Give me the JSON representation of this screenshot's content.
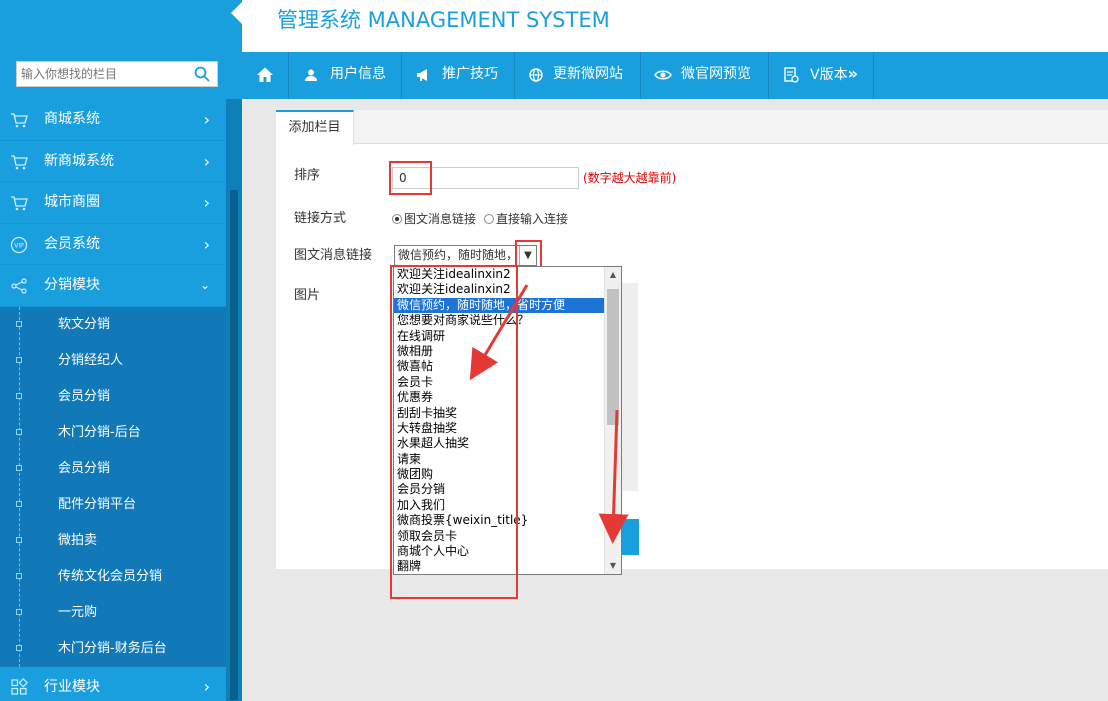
{
  "header": {
    "title": "管理系统 MANAGEMENT SYSTEM"
  },
  "search": {
    "placeholder": "输入你想找的栏目"
  },
  "sidebar": {
    "items": [
      {
        "label": "商城系统",
        "icon": "cart-icon"
      },
      {
        "label": "新商城系统",
        "icon": "cart-icon"
      },
      {
        "label": "城市商圈",
        "icon": "cart-icon"
      },
      {
        "label": "会员系统",
        "icon": "vip-icon"
      },
      {
        "label": "分销模块",
        "icon": "share-icon"
      }
    ],
    "sub_items": [
      "软文分销",
      "分销经纪人",
      "会员分销",
      "木门分销-后台",
      "会员分销",
      "配件分销平台",
      "微拍卖",
      "传统文化会员分销",
      "一元购",
      "木门分销-财务后台"
    ],
    "bottom_item": {
      "label": "行业模块",
      "icon": "grid-icon"
    }
  },
  "topnav": {
    "home_icon": "home-icon",
    "items": [
      {
        "label": "用户信息",
        "icon": "user-icon"
      },
      {
        "label": "推广技巧",
        "icon": "megaphone-icon"
      },
      {
        "label": "更新微网站",
        "icon": "globe-icon"
      },
      {
        "label": "微官网预览",
        "icon": "eye-icon"
      },
      {
        "label": "V版本",
        "icon": "version-icon"
      }
    ]
  },
  "panel": {
    "tab": "添加栏目",
    "order_label": "排序",
    "order_value": "0",
    "order_hint": "(数字越大越靠前)",
    "link_label": "链接方式",
    "radio_option1": "图文消息链接",
    "radio_option2": "直接输入连接",
    "news_label": "图文消息链接",
    "selected_value": "微信预约，随时随地，",
    "image_label": "图片"
  },
  "dropdown": {
    "selected_index": 2,
    "options": [
      "欢迎关注idealinxin2",
      "欢迎关注idealinxin2",
      "微信预约，随时随地，省时方便",
      "您想要对商家说些什么？",
      "在线调研",
      "微相册",
      "微喜帖",
      "会员卡",
      "优惠券",
      "刮刮卡抽奖",
      "大转盘抽奖",
      "水果超人抽奖",
      "请柬",
      "微团购",
      "会员分销",
      "加入我们",
      "微商投票{weixin_title}",
      "领取会员卡",
      "商城个人中心",
      "翻牌"
    ]
  },
  "colors": {
    "primary": "#1a9fde",
    "sidebar_sub": "#1279b9",
    "annotation": "#e53935",
    "hint": "#dd0000"
  }
}
